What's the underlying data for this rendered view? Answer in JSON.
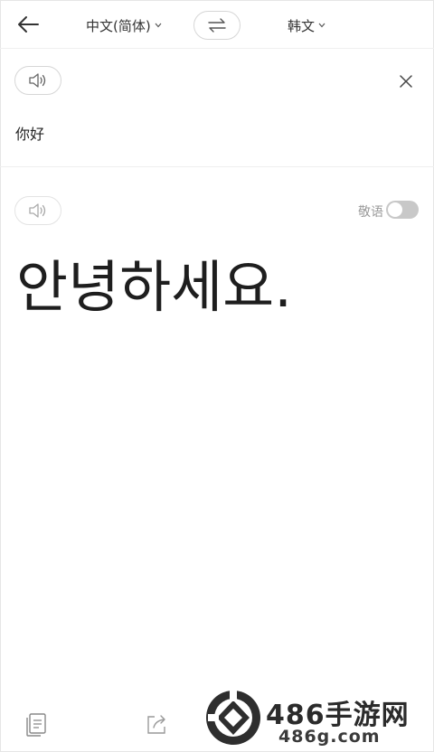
{
  "header": {
    "source_language": "中文(简体)",
    "target_language": "韩文"
  },
  "source": {
    "text": "你好"
  },
  "result": {
    "honorific_label": "敬语",
    "honorific_enabled": false,
    "translated_text": "안녕하세요."
  },
  "watermark": {
    "title": "486手游网",
    "subtitle": "486g.com"
  },
  "icons": {
    "back": "arrow-left-icon",
    "swap": "swap-arrows-icon",
    "speaker": "speaker-icon",
    "clear": "close-icon",
    "copy": "copy-icon",
    "share": "share-icon"
  }
}
